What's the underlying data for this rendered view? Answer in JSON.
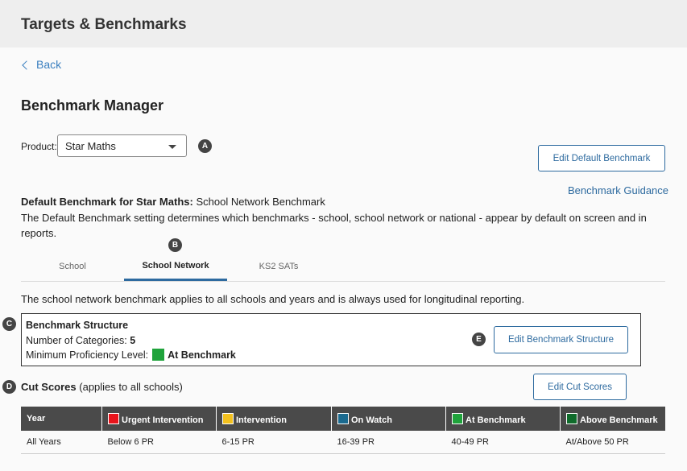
{
  "header": {
    "title": "Targets & Benchmarks"
  },
  "nav": {
    "back_label": "Back"
  },
  "page": {
    "title": "Benchmark Manager"
  },
  "product": {
    "label": "Product:",
    "selected": "Star Maths"
  },
  "markers": {
    "a": "A",
    "b": "B",
    "c": "C",
    "d": "D",
    "e": "E"
  },
  "buttons": {
    "edit_default": "Edit Default Benchmark",
    "edit_structure": "Edit Benchmark Structure",
    "edit_cut_scores": "Edit Cut Scores"
  },
  "links": {
    "guidance": "Benchmark Guidance"
  },
  "default_benchmark": {
    "label": "Default Benchmark for Star Maths:",
    "value": "School Network Benchmark",
    "description": "The Default Benchmark setting determines which benchmarks - school, school network or national - appear by default on screen and in reports."
  },
  "tabs": [
    {
      "label": "School",
      "active": false
    },
    {
      "label": "School Network",
      "active": true
    },
    {
      "label": "KS2 SATs",
      "active": false
    }
  ],
  "tab_intro": "The school network benchmark applies to all schools and years and is always used for longitudinal reporting.",
  "structure": {
    "title": "Benchmark Structure",
    "categories_label": "Number of Categories:",
    "categories_value": "5",
    "min_label": "Minimum Proficiency Level:",
    "min_value": "At Benchmark",
    "min_color": "#1fa33b"
  },
  "cut_scores": {
    "title": "Cut Scores",
    "subtitle": "(applies to all schools)",
    "year_header": "Year",
    "columns": [
      {
        "label": "Urgent Intervention",
        "color": "#e8141b"
      },
      {
        "label": "Intervention",
        "color": "#f2c01e"
      },
      {
        "label": "On Watch",
        "color": "#1b6a8f"
      },
      {
        "label": "At Benchmark",
        "color": "#1fa33b"
      },
      {
        "label": "Above Benchmark",
        "color": "#0f6b2b"
      }
    ],
    "rows": [
      {
        "year": "All Years",
        "values": [
          "Below 6 PR",
          "6-15 PR",
          "16-39 PR",
          "40-49 PR",
          "At/Above 50 PR"
        ]
      }
    ]
  }
}
